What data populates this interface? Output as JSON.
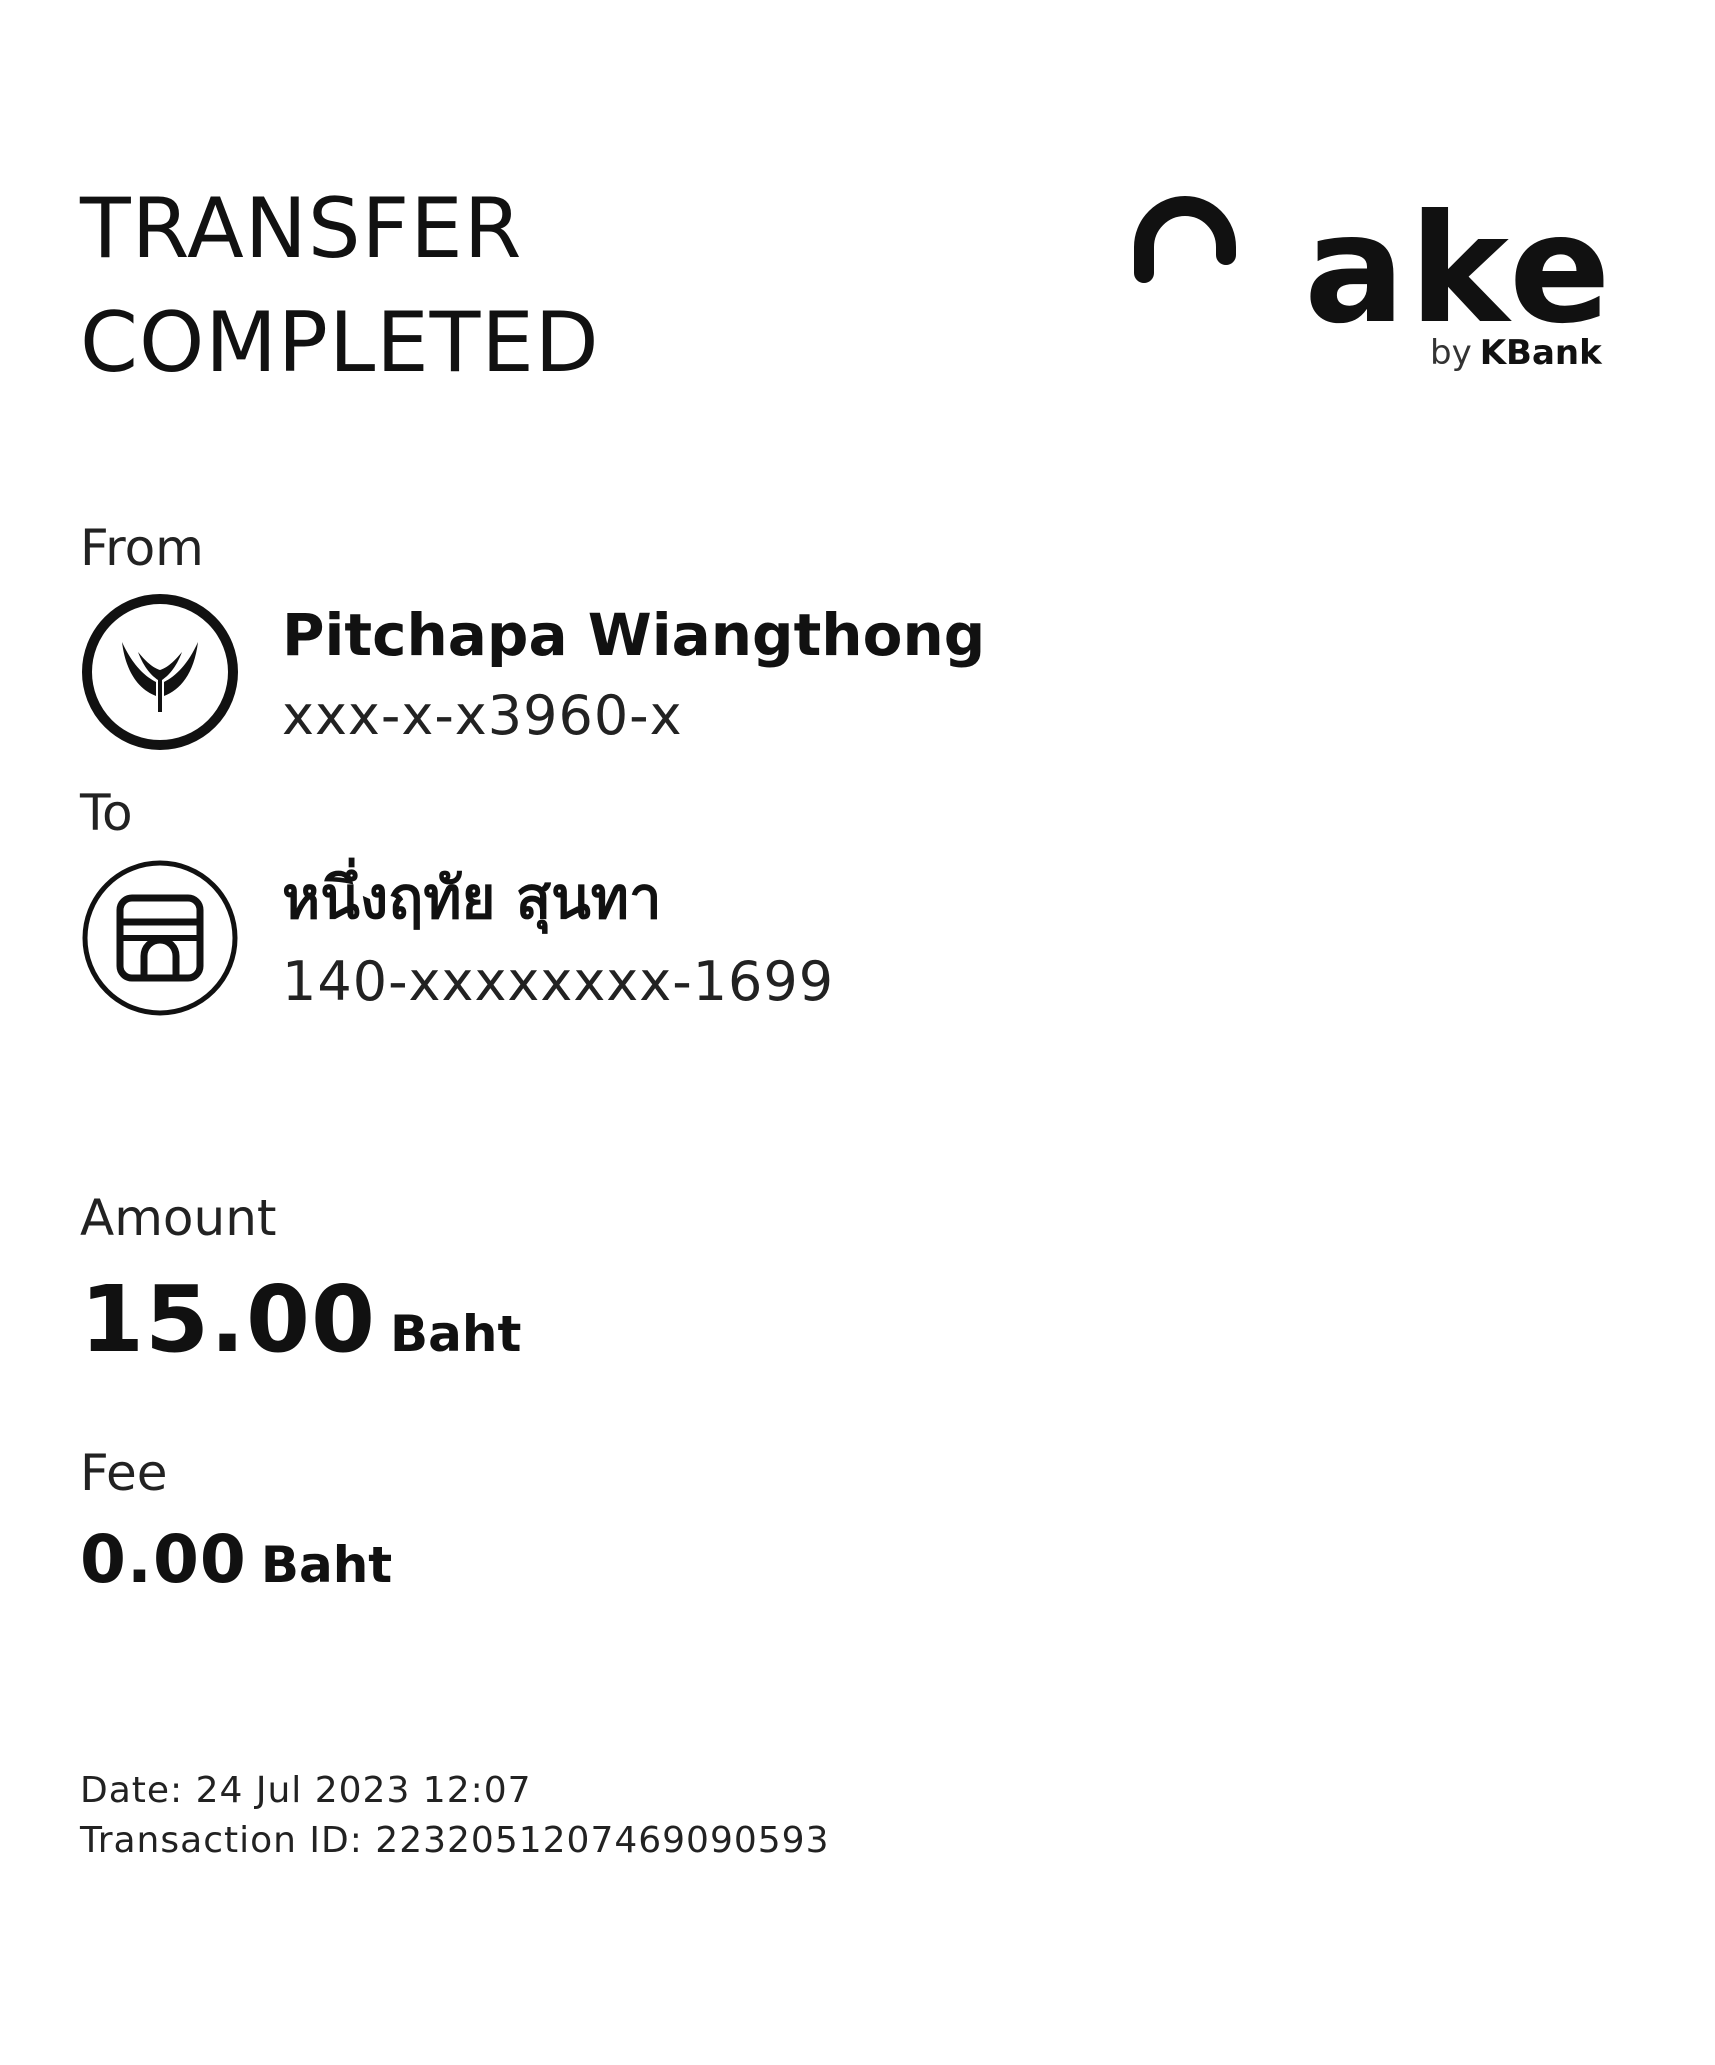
{
  "header": {
    "title_line1": "TRANSFER",
    "title_line2": "COMPLETED"
  },
  "logo": {
    "word": "ake",
    "by": "by",
    "bank": "KBank",
    "icon": "make-logo-arc-icon"
  },
  "from": {
    "label": "From",
    "name": "Pitchapa Wiangthong",
    "account": "xxx-x-x3960-x",
    "icon": "kbank-leaf-icon"
  },
  "to": {
    "label": "To",
    "name": "หนึ่งฤทัย สุนทา",
    "account": "140-xxxxxxxx-1699",
    "icon": "bank-building-icon"
  },
  "amount": {
    "label": "Amount",
    "value": "15.00",
    "currency": "Baht"
  },
  "fee": {
    "label": "Fee",
    "value": "0.00",
    "currency": "Baht"
  },
  "meta": {
    "date": "Date: 24 Jul 2023 12:07",
    "transaction_id": "Transaction ID: 2232051207469090593"
  }
}
